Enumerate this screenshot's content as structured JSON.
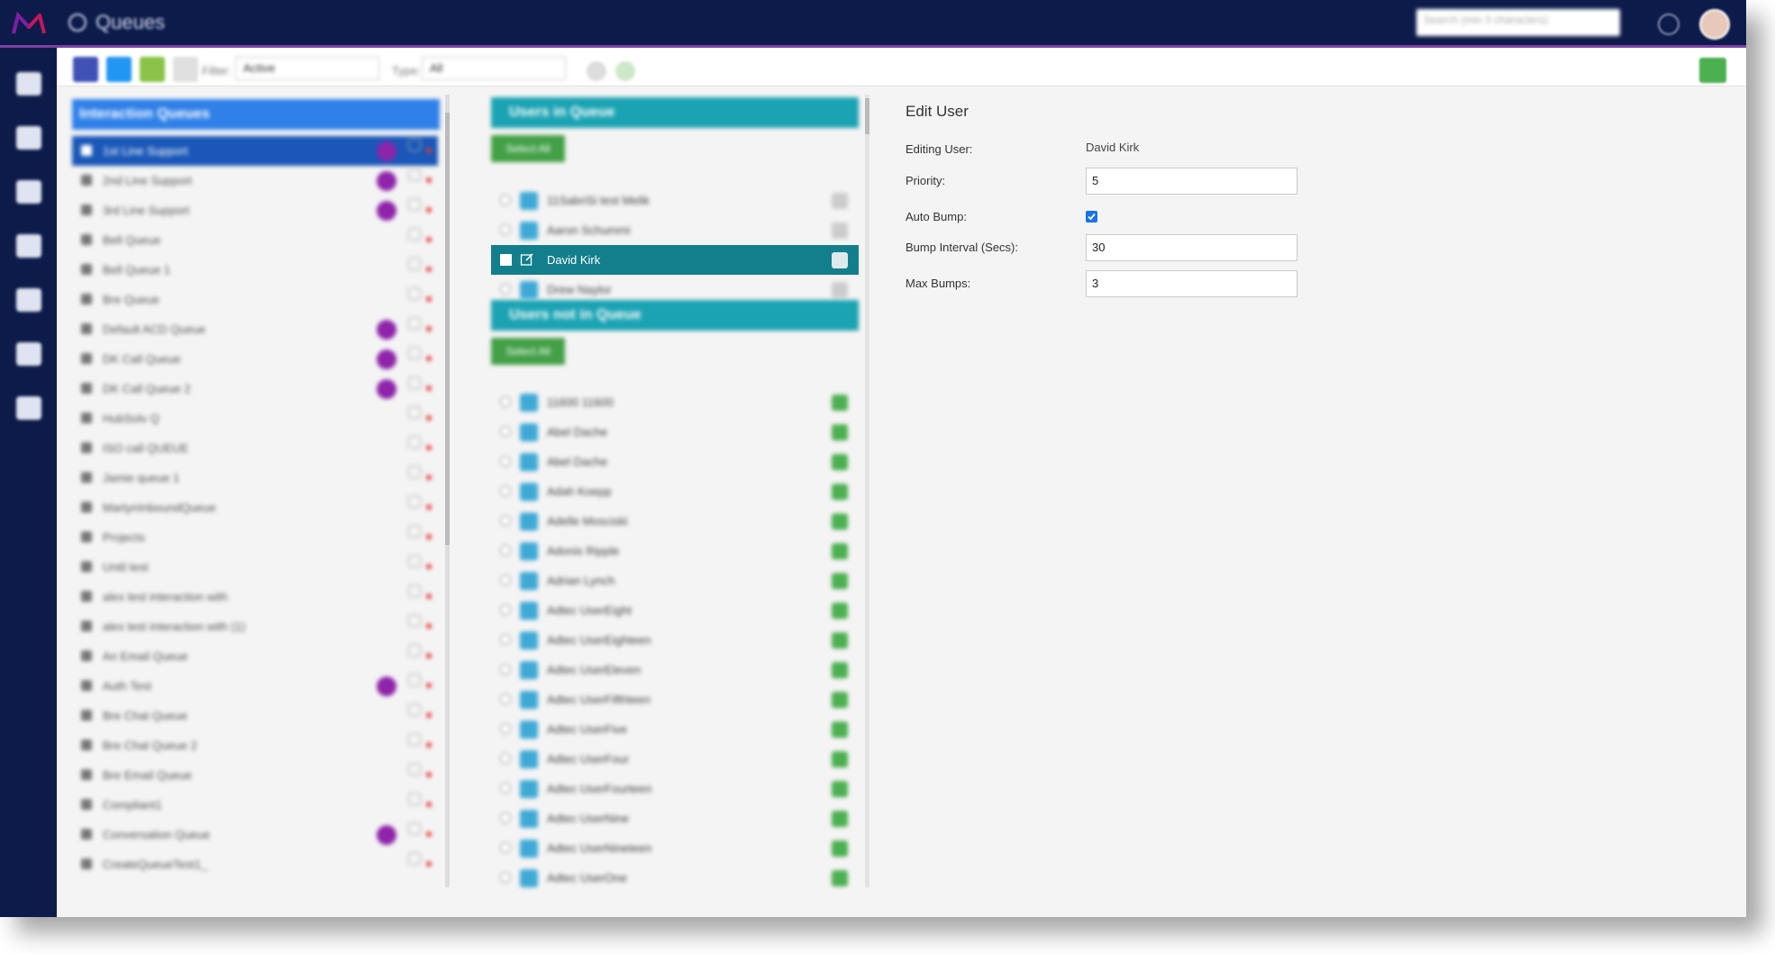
{
  "header": {
    "title": "Queues",
    "search_placeholder": "Search (min 3 characters)",
    "icons": [
      "logo-icon",
      "queues-icon",
      "search-icon",
      "help-icon",
      "avatar"
    ]
  },
  "sidenav": {
    "items": [
      "dashboard-icon",
      "list-icon",
      "speed-icon",
      "database-icon",
      "contacts-icon",
      "document-icon",
      "settings-icon"
    ]
  },
  "toolbar": {
    "filter_label": "Filter:",
    "filter_value": "Active",
    "type_label": "Type:",
    "type_value": "All",
    "colors": {
      "new": "#3f51b5",
      "copy": "#2196f3",
      "filter": "#8bc34a",
      "delete": "#e53935",
      "excel": "#4caf50"
    }
  },
  "queues": {
    "title": "Interaction Queues",
    "items": [
      {
        "label": "1st Line Support",
        "badge": "DK",
        "selected": true
      },
      {
        "label": "2nd Line Support",
        "badge": "DK"
      },
      {
        "label": "3rd Line Support",
        "badge": "DK"
      },
      {
        "label": "Bell Queue",
        "badge": ""
      },
      {
        "label": "Bell Queue 1",
        "badge": ""
      },
      {
        "label": "Bre Queue",
        "badge": ""
      },
      {
        "label": "Default ACD Queue",
        "badge": "DK"
      },
      {
        "label": "DK Call Queue",
        "badge": "DK"
      },
      {
        "label": "DK Call Queue 2",
        "badge": "DK"
      },
      {
        "label": "HubSolv Q",
        "badge": ""
      },
      {
        "label": "ISO call QUEUE",
        "badge": ""
      },
      {
        "label": "Jamie queue 1",
        "badge": ""
      },
      {
        "label": "MartynInboundQueue",
        "badge": ""
      },
      {
        "label": "Projects",
        "badge": ""
      },
      {
        "label": "Until test",
        "badge": ""
      },
      {
        "label": "alex test interaction with",
        "badge": ""
      },
      {
        "label": "alex test interaction with (1)",
        "badge": ""
      },
      {
        "label": "An Email Queue",
        "badge": ""
      },
      {
        "label": "Auth Test",
        "badge": "DK"
      },
      {
        "label": "Bre Chat Queue",
        "badge": ""
      },
      {
        "label": "Bre Chat Queue 2",
        "badge": ""
      },
      {
        "label": "Bre Email Queue",
        "badge": ""
      },
      {
        "label": "Compliant1",
        "badge": ""
      },
      {
        "label": "Conversation Queue",
        "badge": "DK"
      },
      {
        "label": "CreateQueueTest1_",
        "badge": ""
      }
    ]
  },
  "users_in_queue": {
    "title": "Users in Queue",
    "select_all": "Select All",
    "items": [
      {
        "name": "11SabriSi test Melik",
        "selected": false
      },
      {
        "name": "Aaron Schummi",
        "selected": false
      },
      {
        "name": "David Kirk",
        "selected": true
      },
      {
        "name": "Drew Naylor",
        "selected": false
      }
    ]
  },
  "users_not_in_queue": {
    "title": "Users not in Queue",
    "select_all": "Select All",
    "items": [
      "11600 11600",
      "Abel Dache",
      "Abel Dache",
      "Adah Koepp",
      "Adelle Mosciski",
      "Adonis Ripple",
      "Adrian Lynch",
      "Adtec UserEight",
      "Adtec UserEighteen",
      "Adtec UserEleven",
      "Adtec UserFifthteen",
      "Adtec UserFive",
      "Adtec UserFour",
      "Adtec UserFourteen",
      "Adtec UserNine",
      "Adtec UserNineteen",
      "Adtec UserOne"
    ]
  },
  "edit_user": {
    "title": "Edit User",
    "editing_user_label": "Editing User:",
    "editing_user_value": "David Kirk",
    "priority_label": "Priority:",
    "priority_value": "5",
    "auto_bump_label": "Auto Bump:",
    "auto_bump_checked": true,
    "bump_interval_label": "Bump Interval (Secs):",
    "bump_interval_value": "30",
    "max_bumps_label": "Max Bumps:",
    "max_bumps_value": "3"
  }
}
